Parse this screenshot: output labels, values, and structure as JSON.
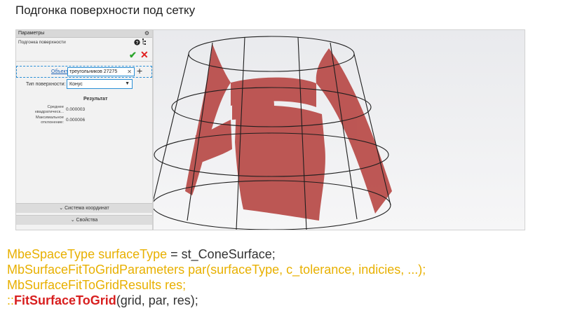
{
  "title": "Подгонка поверхности под сетку",
  "panel": {
    "header": "Параметры",
    "subtitle": "Подгонка поверхности",
    "help_icon": "❓",
    "tree_icon": "⋮",
    "object_label": "Объект",
    "object_value": "треугольников 27275",
    "surface_type_label": "Тип поверхности:",
    "surface_type_value": "Конус",
    "result_header": "Результат",
    "mean_label": "Среднее квадратическ...",
    "mean_value": "0.000003",
    "max_label": "Максимальное отклонение:",
    "max_value": "0.000006",
    "coord_system": "Система координат",
    "properties": "Свойства"
  },
  "code": {
    "line1": {
      "type": "MbeSpaceType",
      "var": "surfaceType",
      "rest": " = st_ConeSurface;"
    },
    "line2": {
      "type": "MbSurfaceFitToGridParameters",
      "call": "par(surfaceType, c_tolerance, indicies, ...);"
    },
    "line3": {
      "type": "MbSurfaceFitToGridResults",
      "var": "res;"
    },
    "line4": {
      "prefix": "::",
      "func": "FitSurfaceToGrid",
      "args": "(grid, par, res);"
    }
  },
  "colors": {
    "code_type": "#e8b000",
    "code_func": "#d81f1f",
    "surface": "#b84a47",
    "check": "#2aa52a",
    "cancel": "#e02020",
    "link": "#1a5fb4"
  }
}
